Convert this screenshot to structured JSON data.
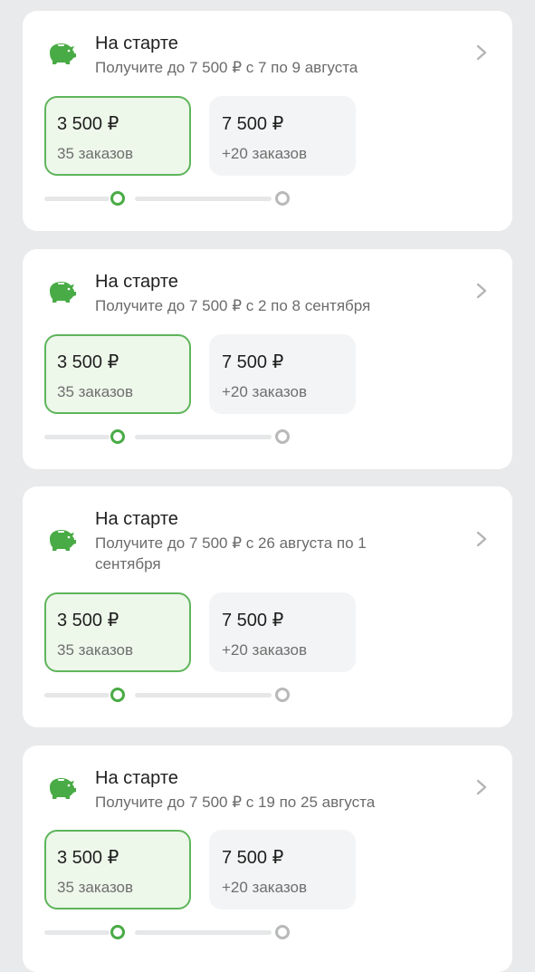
{
  "colors": {
    "accent": "#49ab45",
    "tile_active_bg": "#edf7ea",
    "muted": "#b8b9bb"
  },
  "cards": [
    {
      "icon": "piggy-bank-icon",
      "title": "На старте",
      "subtitle": "Получите до 7 500 ₽ с 7 по 9 августа",
      "tiles": [
        {
          "amount": "3 500 ₽",
          "orders": "35 заказов"
        },
        {
          "amount": "7 500 ₽",
          "orders": "+20 заказов"
        }
      ]
    },
    {
      "icon": "piggy-bank-icon",
      "title": "На старте",
      "subtitle": "Получите до 7 500 ₽ с 2 по 8 сентября",
      "tiles": [
        {
          "amount": "3 500 ₽",
          "orders": "35 заказов"
        },
        {
          "amount": "7 500 ₽",
          "orders": "+20 заказов"
        }
      ]
    },
    {
      "icon": "piggy-bank-icon",
      "title": "На старте",
      "subtitle": "Получите до 7 500 ₽ с 26 августа по 1 сентября",
      "tiles": [
        {
          "amount": "3 500 ₽",
          "orders": "35 заказов"
        },
        {
          "amount": "7 500 ₽",
          "orders": "+20 заказов"
        }
      ]
    },
    {
      "icon": "piggy-bank-icon",
      "title": "На старте",
      "subtitle": "Получите до 7 500 ₽ с 19 по 25 августа",
      "tiles": [
        {
          "amount": "3 500 ₽",
          "orders": "35 заказов"
        },
        {
          "amount": "7 500 ₽",
          "orders": "+20 заказов"
        }
      ]
    }
  ]
}
